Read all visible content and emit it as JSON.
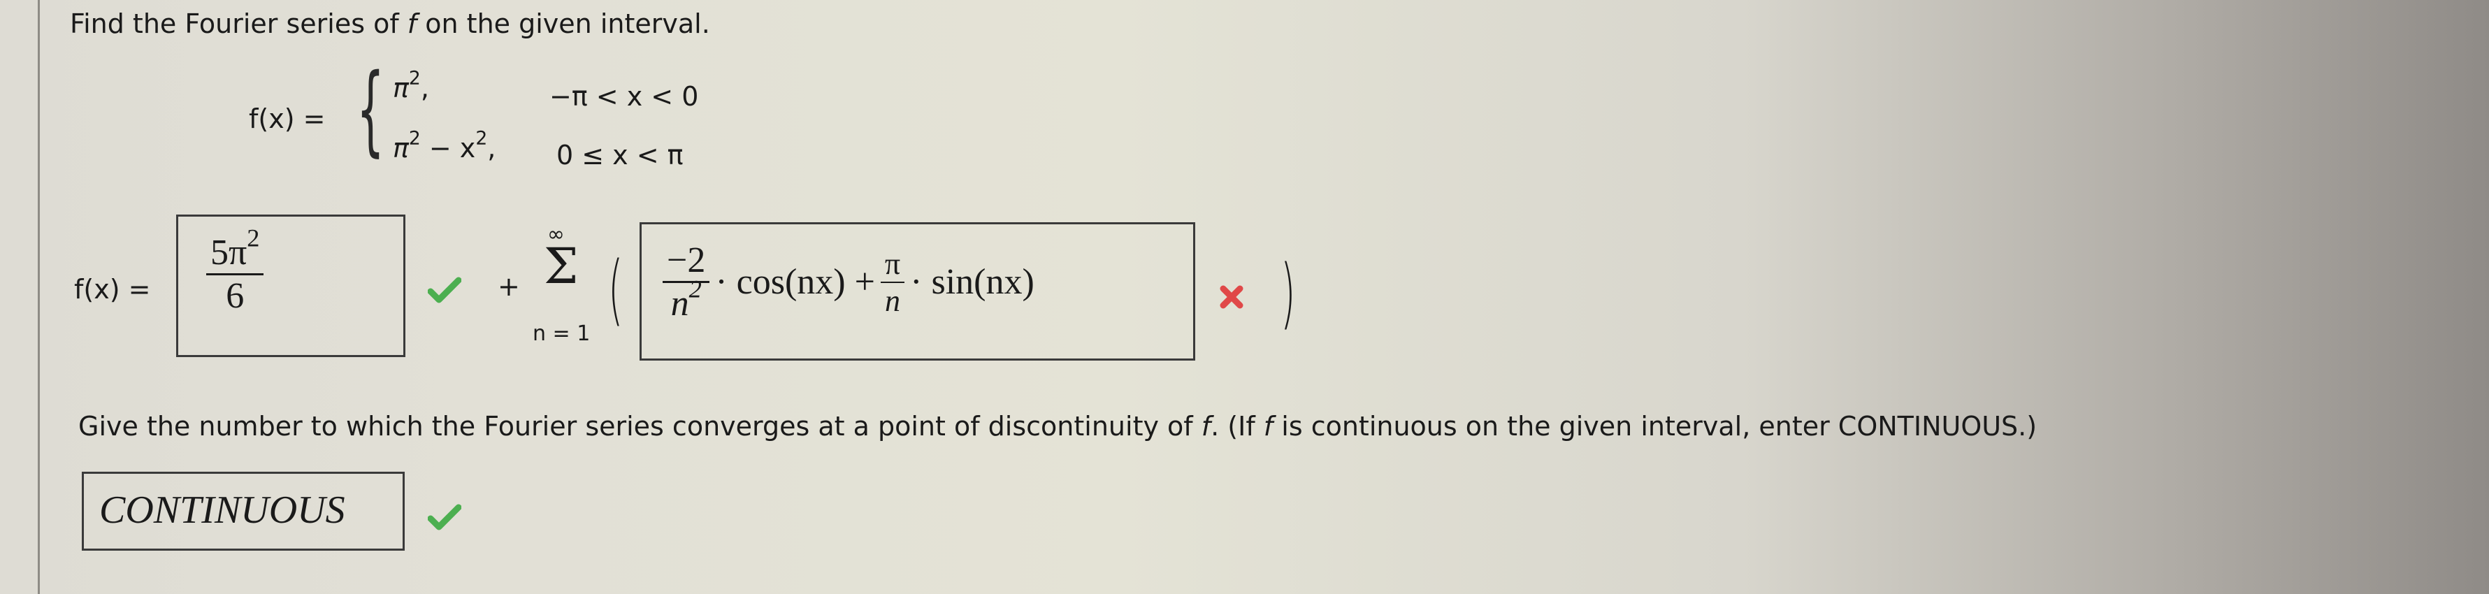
{
  "prompt": {
    "title_pre": "Find the Fourier series of ",
    "title_f": "f",
    "title_post": " on the given interval."
  },
  "definition": {
    "lhs": "f(x) =",
    "cases": [
      {
        "expr_base": "π",
        "expr_sup": "2",
        "expr_tail": ",",
        "condition": "−π < x < 0"
      },
      {
        "expr_base": "π",
        "expr_sup": "2",
        "expr_mid": " − x",
        "expr_sup2": "2",
        "expr_tail": ",",
        "condition": "0 ≤ x < π"
      }
    ]
  },
  "series": {
    "lhs": "f(x) =",
    "a0_answer": {
      "num_base": "5π",
      "num_sup": "2",
      "den": "6",
      "status": "correct"
    },
    "plus": "+",
    "sum_upper": "∞",
    "sum_symbol": "Σ",
    "sum_lower": "n = 1",
    "open_paren": "(",
    "close_paren": ")",
    "term_answer": {
      "cos_coef_num": "−2",
      "cos_coef_den_base": "n",
      "cos_coef_den_sup": "2",
      "cos_part": "· cos(nx) +",
      "sin_coef_num": "π",
      "sin_coef_den": "n",
      "sin_part": "· sin(nx)",
      "status": "incorrect"
    }
  },
  "convergence": {
    "question_pre": "Give the number to which the Fourier series converges at a point of discontinuity of ",
    "f1": "f",
    "question_mid": ". (If ",
    "f2": "f",
    "question_post": " is continuous on the given interval, enter CONTINUOUS.)",
    "answer": "CONTINUOUS",
    "status": "correct"
  },
  "icons": {
    "correct": "check-icon",
    "incorrect": "x-icon"
  },
  "colors": {
    "correct": "#4caf50",
    "incorrect": "#e04848",
    "text": "#1a1a1a"
  }
}
